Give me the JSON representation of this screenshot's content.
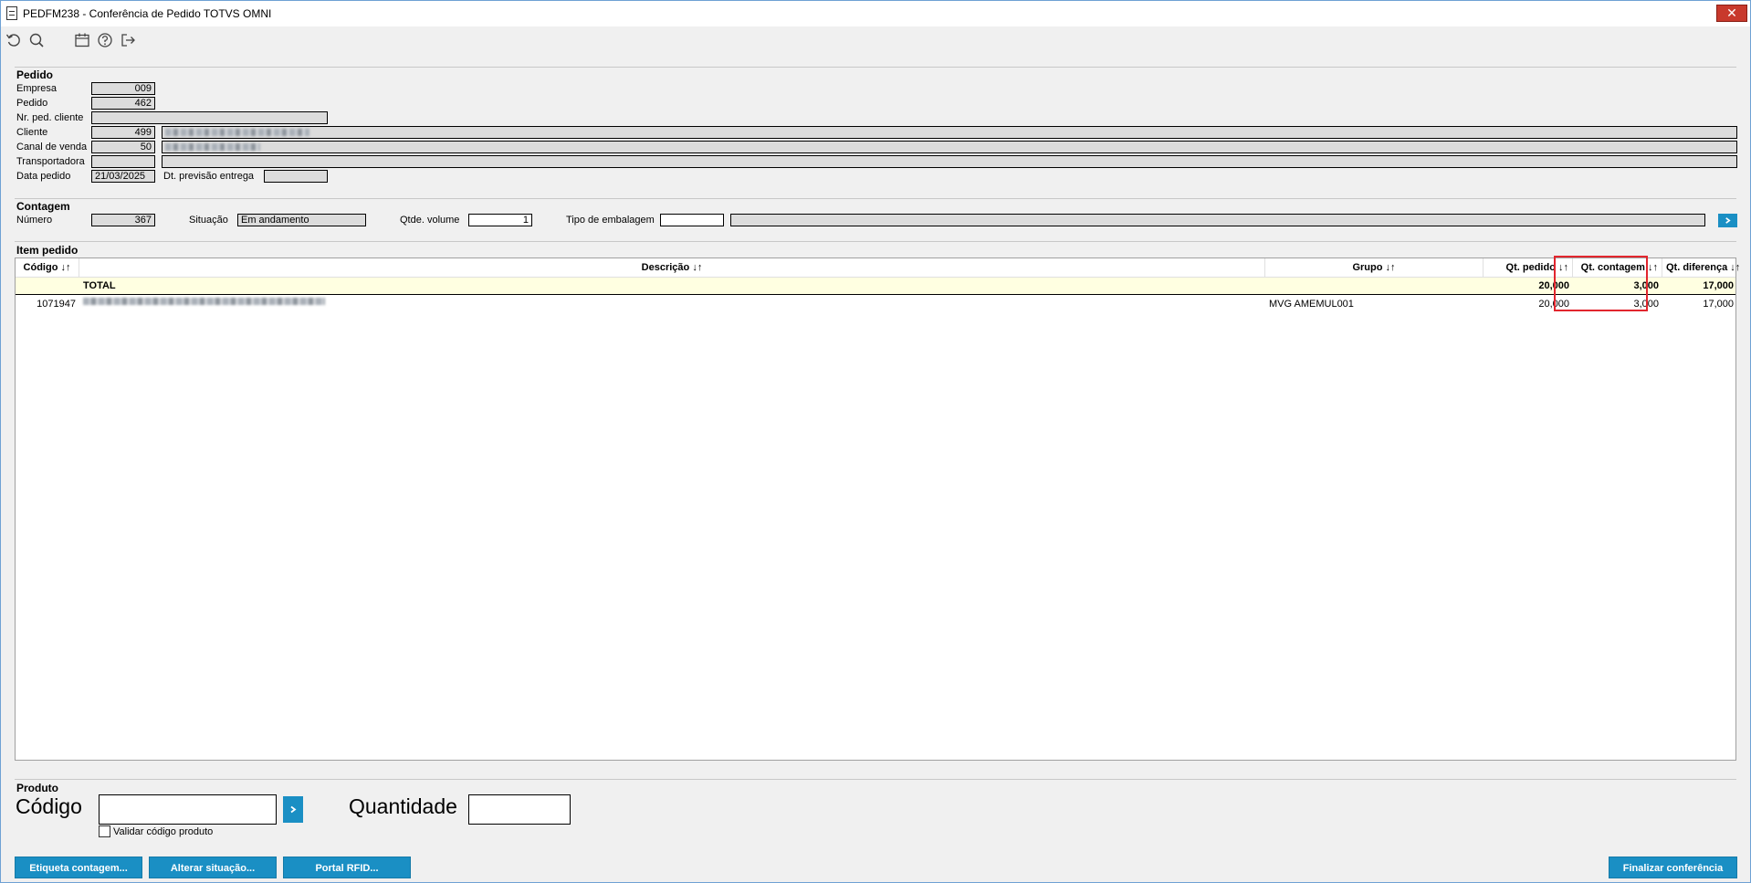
{
  "window": {
    "title": "PEDFM238 - Conferência de Pedido TOTVS OMNI",
    "close_label": "✕"
  },
  "toolbar": {
    "icons": [
      "refresh-icon",
      "search-icon",
      "calendar-icon",
      "help-icon",
      "exit-icon"
    ]
  },
  "pedido": {
    "title": "Pedido",
    "empresa_label": "Empresa",
    "empresa_value": "009",
    "pedido_label": "Pedido",
    "pedido_value": "462",
    "nr_ped_cliente_label": "Nr. ped. cliente",
    "nr_ped_cliente_value": "",
    "cliente_label": "Cliente",
    "cliente_value": "499",
    "canal_label": "Canal de venda",
    "canal_value": "50",
    "transportadora_label": "Transportadora",
    "transportadora_value": "",
    "data_pedido_label": "Data pedido",
    "data_pedido_value": "21/03/2025",
    "dt_previsao_label": "Dt. previsão entrega",
    "dt_previsao_value": ""
  },
  "contagem": {
    "title": "Contagem",
    "numero_label": "Número",
    "numero_value": "367",
    "situacao_label": "Situação",
    "situacao_value": "Em andamento",
    "qtde_volume_label": "Qtde. volume",
    "qtde_volume_value": "1",
    "tipo_embalagem_label": "Tipo de embalagem",
    "tipo_embalagem_value": ""
  },
  "item_pedido": {
    "title": "Item pedido",
    "columns": [
      "Código ↓↑",
      "Descrição ↓↑",
      "Grupo ↓↑",
      "Qt. pedido ↓↑",
      "Qt. contagem ↓↑",
      "Qt. diferença ↓↑"
    ],
    "total": {
      "label": "TOTAL",
      "qt_pedido": "20,000",
      "qt_contagem": "3,000",
      "qt_diferenca": "17,000"
    },
    "rows": [
      {
        "codigo": "1071947",
        "grupo": "MVG AMEMUL001",
        "qt_pedido": "20,000",
        "qt_contagem": "3,000",
        "qt_diferenca": "17,000"
      }
    ]
  },
  "produto": {
    "title": "Produto",
    "codigo_label": "Código",
    "codigo_value": "",
    "quantidade_label": "Quantidade",
    "quantidade_value": "",
    "validar_label": "Validar código produto",
    "validar_checked": false
  },
  "buttons": {
    "etiqueta": "Etiqueta contagem...",
    "alterar": "Alterar situação...",
    "portal": "Portal RFID...",
    "finalizar": "Finalizar conferência"
  },
  "colors": {
    "accent": "#1a8fc4",
    "highlight": "#e2262e",
    "total_row": "#ffffe1"
  }
}
